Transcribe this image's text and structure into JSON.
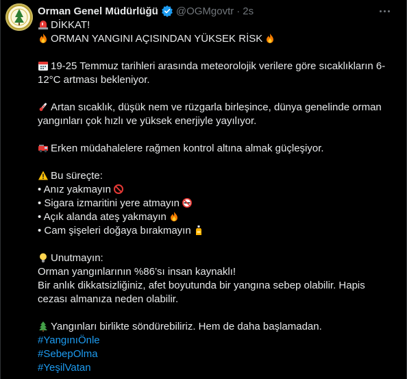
{
  "author": {
    "name": "Orman Genel Müdürlüğü",
    "handle": "@OGMgovtr",
    "separator": "·",
    "time": "2s",
    "avatar_icon": "ogm-logo",
    "verified_icon": "verified-badge-icon",
    "verified_color": "#1d9bf0"
  },
  "more_icon": "more-options-icon",
  "content": {
    "l1": "DİKKAT!",
    "l2": "ORMAN YANGINI AÇISINDAN YÜKSEK RİSK",
    "l3": "19-25 Temmuz tarihleri arasında meteorolojik verilere göre sıcaklıkların 6-12°C artması bekleniyor.",
    "l4": "Artan sıcaklık, düşük nem ve rüzgarla birleşince, dünya genelinde orman yangınları çok hızlı ve yüksek enerjiyle yayılıyor.",
    "l5": "Erken müdahalelere rağmen kontrol altına almak güçleşiyor.",
    "l6": "Bu süreçte:",
    "b1": "• Anız yakmayın",
    "b2": "• Sigara izmaritini yere atmayın",
    "b3": "• Açık alanda ateş yakmayın",
    "b4": "• Cam şişeleri doğaya bırakmayın",
    "l7": "Unutmayın:",
    "l8": "Orman yangınlarının %86’sı insan kaynaklı!",
    "l9": "Bir anlık dikkatsizliğiniz, afet boyutunda bir yangına sebep olabilir. Hapis cezası  almanıza neden olabilir.",
    "l10": "Yangınları birlikte söndürebiliriz. Hem de daha başlamadan.",
    "hashtags": [
      "#YangınıÖnle",
      "#SebepOlma",
      "#YeşilVatan"
    ]
  },
  "colors": {
    "background": "#000000",
    "text": "#e7e9ea",
    "secondary": "#71767b",
    "link": "#1d9bf0"
  },
  "emoji_icons": [
    "siren-icon",
    "fire-icon",
    "calendar-icon",
    "thermometer-icon",
    "fire-engine-icon",
    "warning-icon",
    "prohibited-icon",
    "no-smoking-icon",
    "bottle-icon",
    "lightbulb-icon",
    "tree-icon"
  ]
}
